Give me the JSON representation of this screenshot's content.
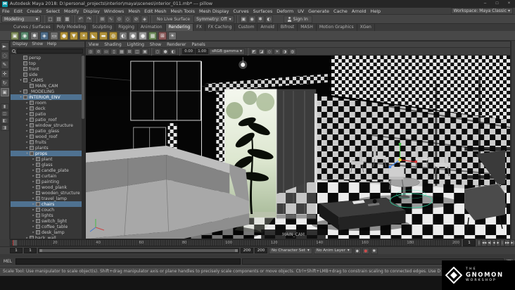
{
  "ui": {
    "caret": "▾",
    "maya_badge": "M",
    "more_dots": "⋮",
    "shelf_up": "▴",
    "shelf_down": "▾",
    "script_icon": "▤"
  },
  "titlebar": {
    "title": "Autodesk Maya 2018: D:\\personal_projects\\interior\\maya\\scenes\\interior_011.mb* --- pillow",
    "minimize": "–",
    "maximize": "□",
    "close": "×"
  },
  "menubar": {
    "items": [
      "File",
      "Edit",
      "Create",
      "Select",
      "Modify",
      "Display",
      "Windows",
      "Mesh",
      "Edit Mesh",
      "Mesh Tools",
      "Mesh Display",
      "Curves",
      "Surfaces",
      "Deform",
      "UV",
      "Generate",
      "Cache",
      "Arnold",
      "Help"
    ],
    "workspace": "Workspace: Maya Classic"
  },
  "statusline": {
    "menuset": "Modeling",
    "file_icons": [
      {
        "name": "new-scene-icon",
        "glyph": "□"
      },
      {
        "name": "open-scene-icon",
        "glyph": "▤"
      },
      {
        "name": "save-scene-icon",
        "glyph": "▦"
      }
    ],
    "edit_icons": [
      {
        "name": "undo-icon",
        "glyph": "↶"
      },
      {
        "name": "redo-icon",
        "glyph": "↷"
      }
    ],
    "snap_icons": [
      {
        "name": "snap-grid-icon",
        "glyph": "⊞"
      },
      {
        "name": "snap-curve-icon",
        "glyph": "∿"
      },
      {
        "name": "snap-point-icon",
        "glyph": "⊙"
      },
      {
        "name": "snap-plane-icon",
        "glyph": "◇"
      },
      {
        "name": "make-live-icon",
        "glyph": "⊘"
      },
      {
        "name": "snap-center-icon",
        "glyph": "◈"
      }
    ],
    "render_icons": [
      {
        "name": "render-frame-icon",
        "glyph": "▣"
      },
      {
        "name": "ipr-render-icon",
        "glyph": "◉"
      },
      {
        "name": "render-settings-icon",
        "glyph": "✱"
      },
      {
        "name": "hypershade-icon",
        "glyph": "◐"
      }
    ],
    "no_live_surface": "No Live Surface",
    "symmetry": "Symmetry: Off",
    "sign_in": "Sign In"
  },
  "shelf": {
    "tabs": [
      {
        "label": "Curves / Surfaces"
      },
      {
        "label": "Poly Modeling"
      },
      {
        "label": "Sculpting"
      },
      {
        "label": "Rigging"
      },
      {
        "label": "Animation"
      },
      {
        "label": "Rendering",
        "active": true
      },
      {
        "label": "FX"
      },
      {
        "label": "FX Caching"
      },
      {
        "label": "Custom"
      },
      {
        "label": "Arnold"
      },
      {
        "label": "Bifrost"
      },
      {
        "label": "MASH"
      },
      {
        "label": "Motion Graphics"
      },
      {
        "label": "XGen"
      }
    ],
    "icons": [
      {
        "name": "render-current-frame-icon",
        "color": "#7d8a5a",
        "glyph": "▣"
      },
      {
        "name": "ipr-render-icon",
        "color": "#5a8a6e",
        "glyph": "◉"
      },
      {
        "name": "render-settings-icon",
        "color": "#6f6f6f",
        "glyph": "✱"
      },
      {
        "name": "hypershade-icon",
        "color": "#4f6d8a",
        "glyph": "◈"
      },
      {
        "name": "render-view-icon",
        "color": "#6f6f6f",
        "glyph": "▭"
      },
      {
        "name": "ambient-light-icon",
        "color": "#b0913a",
        "glyph": "●"
      },
      {
        "name": "directional-light-icon",
        "color": "#b0913a",
        "glyph": "▼"
      },
      {
        "name": "point-light-icon",
        "color": "#b0913a",
        "glyph": "✶"
      },
      {
        "name": "spot-light-icon",
        "color": "#b0913a",
        "glyph": "◣"
      },
      {
        "name": "area-light-icon",
        "color": "#b0913a",
        "glyph": "▬"
      },
      {
        "name": "volume-light-icon",
        "color": "#b0913a",
        "glyph": "◍"
      },
      {
        "name": "shading-group-icon",
        "color": "#777777",
        "glyph": "◐"
      },
      {
        "name": "blinn-material-icon",
        "color": "#8a8a8a",
        "glyph": "●"
      },
      {
        "name": "lambert-material-icon",
        "color": "#9a9a9a",
        "glyph": "●"
      },
      {
        "name": "texture-icon",
        "color": "#6d8a5a",
        "glyph": "▦"
      },
      {
        "name": "utility-node-icon",
        "color": "#8a5a5a",
        "glyph": "⊞"
      },
      {
        "name": "light-editor-icon",
        "color": "#6f6f6f",
        "glyph": "☀"
      }
    ]
  },
  "toolbox": {
    "tools": [
      {
        "name": "select-tool",
        "glyph": "►"
      },
      {
        "name": "lasso-tool",
        "glyph": "◌"
      },
      {
        "name": "paint-select-tool",
        "glyph": "✎"
      },
      {
        "name": "move-tool",
        "glyph": "✛"
      },
      {
        "name": "rotate-tool",
        "glyph": "↻"
      },
      {
        "name": "scale-tool",
        "glyph": "▣",
        "active": true
      }
    ],
    "layouts": [
      {
        "name": "single-pane-layout-button",
        "glyph": "▮"
      },
      {
        "name": "four-pane-layout-button",
        "glyph": "◫"
      },
      {
        "name": "persp-outliner-layout-button",
        "glyph": "◧"
      },
      {
        "name": "split-pane-layout-button",
        "glyph": "◨"
      }
    ]
  },
  "outliner": {
    "menus": [
      "Display",
      "Show",
      "Help"
    ],
    "items": [
      {
        "label": "persp",
        "level": 1,
        "exp": ""
      },
      {
        "label": "top",
        "level": 1,
        "exp": ""
      },
      {
        "label": "front",
        "level": 1,
        "exp": ""
      },
      {
        "label": "side",
        "level": 1,
        "exp": ""
      },
      {
        "label": "_CAMS",
        "level": 1,
        "exp": "▾"
      },
      {
        "label": "MAIN_CAM",
        "level": 2,
        "exp": ""
      },
      {
        "label": "_MODELING",
        "level": 1,
        "exp": "▸"
      },
      {
        "label": "INTERIOR_ENV",
        "level": 1,
        "exp": "▾",
        "selected": true
      },
      {
        "label": "room",
        "level": 2,
        "exp": "▸"
      },
      {
        "label": "deck",
        "level": 2,
        "exp": "▸"
      },
      {
        "label": "patio",
        "level": 2,
        "exp": "▸"
      },
      {
        "label": "patio_roof",
        "level": 2,
        "exp": "▸"
      },
      {
        "label": "window_structure",
        "level": 2,
        "exp": "▸"
      },
      {
        "label": "patio_glass",
        "level": 2,
        "exp": "▸"
      },
      {
        "label": "wood_roof",
        "level": 2,
        "exp": "▸"
      },
      {
        "label": "fruits",
        "level": 2,
        "exp": "▸"
      },
      {
        "label": "plants",
        "level": 2,
        "exp": "▸"
      },
      {
        "label": "props",
        "level": 2,
        "exp": "▾",
        "selected": true
      },
      {
        "label": "plant",
        "level": 3,
        "exp": "▸"
      },
      {
        "label": "glass",
        "level": 3,
        "exp": "▸"
      },
      {
        "label": "candle_plate",
        "level": 3,
        "exp": "▸"
      },
      {
        "label": "curtain",
        "level": 3,
        "exp": "▸"
      },
      {
        "label": "painting",
        "level": 3,
        "exp": "▸"
      },
      {
        "label": "wood_plank",
        "level": 3,
        "exp": "▸"
      },
      {
        "label": "wooden_structure",
        "level": 3,
        "exp": "▸"
      },
      {
        "label": "travel_lamp",
        "level": 3,
        "exp": "▸"
      },
      {
        "label": "chairs",
        "level": 3,
        "exp": "▸",
        "selected": true
      },
      {
        "label": "couch",
        "level": 3,
        "exp": "▸"
      },
      {
        "label": "lights",
        "level": 3,
        "exp": "▸"
      },
      {
        "label": "switch_light",
        "level": 3,
        "exp": "▸"
      },
      {
        "label": "coffee_table",
        "level": 3,
        "exp": "▸"
      },
      {
        "label": "desk_lamp",
        "level": 3,
        "exp": "▸"
      },
      {
        "label": "back_wall",
        "level": 2,
        "exp": "▸"
      }
    ]
  },
  "viewport": {
    "menus": [
      "View",
      "Shading",
      "Lighting",
      "Show",
      "Renderer",
      "Panels"
    ],
    "icons_left": [
      {
        "name": "select-camera-icon",
        "glyph": "◎"
      },
      {
        "name": "lock-camera-icon",
        "glyph": "⊘"
      },
      {
        "name": "film-gate-icon",
        "glyph": "▭"
      },
      {
        "name": "resolution-gate-icon",
        "glyph": "▯"
      },
      {
        "name": "gate-mask-icon",
        "glyph": "▦"
      },
      {
        "name": "field-chart-icon",
        "glyph": "⊞"
      },
      {
        "name": "safe-action-icon",
        "glyph": "◫"
      },
      {
        "name": "safe-title-icon",
        "glyph": "▣"
      }
    ],
    "shading_balls": [
      {
        "name": "wireframe-sphere-icon",
        "glyph": "○"
      },
      {
        "name": "shaded-sphere-icon",
        "glyph": "●"
      },
      {
        "name": "textured-sphere-icon",
        "glyph": "◐"
      }
    ],
    "exposure": "0.00",
    "gamma": "1.00",
    "view_transform": "sRGB gamma",
    "icons_right": [
      {
        "name": "isolate-select-icon",
        "glyph": "◩"
      },
      {
        "name": "xray-icon",
        "glyph": "◪"
      },
      {
        "name": "wireframe-on-shaded-icon",
        "glyph": "◇"
      },
      {
        "name": "default-lighting-icon",
        "glyph": "☀"
      },
      {
        "name": "shadows-icon",
        "glyph": "◑"
      },
      {
        "name": "ao-icon",
        "glyph": "◍"
      }
    ],
    "camera_label": "MAIN_CAM"
  },
  "timeslider": {
    "labels": [
      "1",
      "20",
      "40",
      "60",
      "80",
      "100",
      "120",
      "140",
      "160",
      "180",
      "200"
    ],
    "current": "1"
  },
  "playback": {
    "buttons": [
      {
        "name": "go-to-start-button",
        "glyph": "|◀"
      },
      {
        "name": "step-back-frame-button",
        "glyph": "◀◀"
      },
      {
        "name": "step-back-key-button",
        "glyph": "◀|"
      },
      {
        "name": "play-backwards-button",
        "glyph": "◀"
      },
      {
        "name": "play-forwards-button",
        "glyph": "▶"
      },
      {
        "name": "step-forward-key-button",
        "glyph": "|▶"
      },
      {
        "name": "step-forward-frame-button",
        "glyph": "▶▶"
      },
      {
        "name": "go-to-end-button",
        "glyph": "▶|"
      }
    ]
  },
  "rangeslider": {
    "animation_start": "1",
    "playback_start": "1",
    "playback_end": "200",
    "animation_end": "200",
    "character_set": "No Character Set",
    "anim_layer": "No Anim Layer"
  },
  "commandline": {
    "label": "MEL"
  },
  "helpline": {
    "text": "Scale Tool: Use manipulator to scale object(s). Shift+drag manipulator axis or plane handles to precisely scale components or move objects. Ctrl+Shift+LMB+drag to constrain scaling to connected edges. Use D or INSERT to change the pivot position and axis orientation."
  },
  "logo": {
    "the": "THE",
    "gnomon": "GNOMON",
    "workshop": "WORKSHOP"
  },
  "colors": {
    "selection": "#4f7291",
    "accent": "#5285a6",
    "manip_x": "#d33535",
    "manip_y": "#44bb44",
    "manip_z": "#4488ee",
    "manip_center": "#ece52e"
  }
}
